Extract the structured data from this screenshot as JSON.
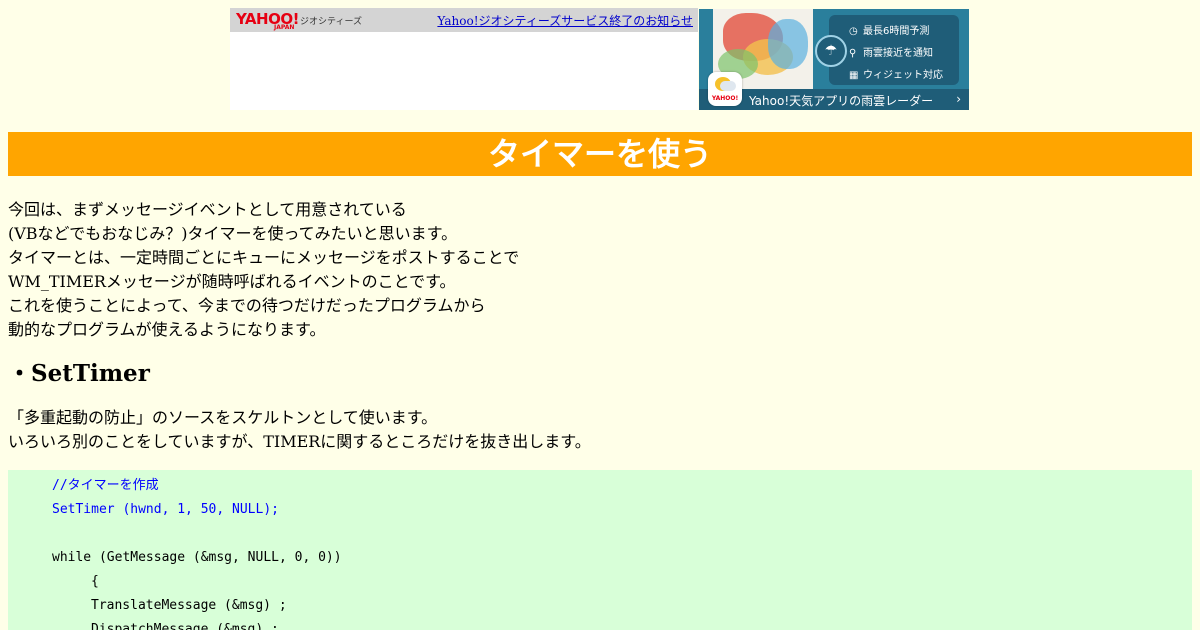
{
  "banner": {
    "logo_text": "YAHOO!",
    "logo_sub": "JAPAN",
    "service_name": "ジオシティーズ",
    "notice_link": "Yahoo!ジオシティーズサービス終了のお知らせ"
  },
  "weather_ad": {
    "app_icon_text": "YAHOO!",
    "features": [
      "最長6時間予測",
      "雨雲接近を通知",
      "ウィジェット対応"
    ],
    "footer_text": "Yahoo!天気アプリの雨雲レーダー",
    "footer_arrow": "›"
  },
  "page_title": "タイマーを使う",
  "intro_lines": [
    "今回は、まずメッセージイベントとして用意されている",
    "(VBなどでもおなじみ？)タイマーを使ってみたいと思います。",
    "タイマーとは、一定時間ごとにキューにメッセージをポストすることで",
    "WM_TIMERメッセージが随時呼ばれるイベントのことです。",
    "これを使うことによって、今までの待つだけだったプログラムから",
    "動的なプログラムが使えるようになります。"
  ],
  "section_heading": "・SetTimer",
  "section_lines": [
    "「多重起動の防止」のソースをスケルトンとして使います。",
    "いろいろ別のことをしていますが、TIMERに関するところだけを抜き出します。"
  ],
  "code": [
    "//タイマーを作成",
    "SetTimer (hwnd, 1, 50, NULL);",
    "while (GetMessage (&msg, NULL, 0, 0))",
    "{",
    "TranslateMessage (&msg) ;",
    "DispatchMessage (&msg) ;"
  ],
  "colors": {
    "background": "#ffffe8",
    "title_bg": "#ffa500",
    "code_bg": "#d8ffd8",
    "code_highlight": "#0000ff"
  }
}
